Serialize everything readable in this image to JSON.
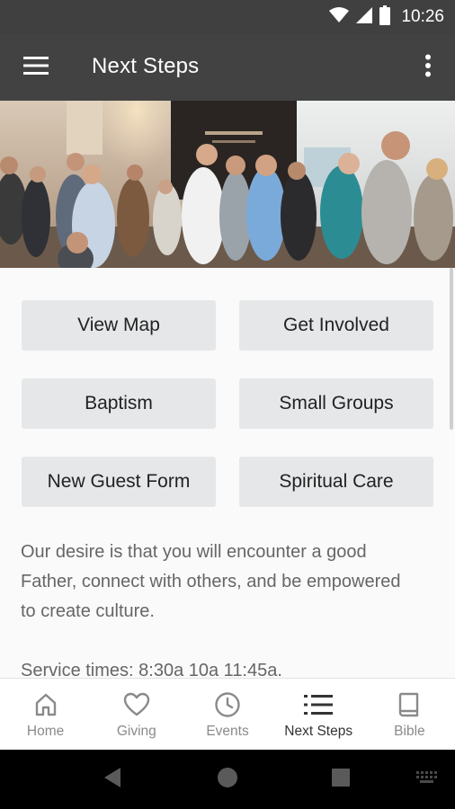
{
  "status_bar": {
    "time": "10:26",
    "icons": [
      "wifi-icon",
      "cellular-icon",
      "battery-icon"
    ]
  },
  "app_bar": {
    "title": "Next Steps",
    "menu_icon": "hamburger-menu-icon",
    "overflow_icon": "more-vert-icon"
  },
  "hero": {
    "description": "photo of people gathered and talking in a church lobby"
  },
  "actions": [
    {
      "label": "View Map"
    },
    {
      "label": "Get Involved"
    },
    {
      "label": "Baptism"
    },
    {
      "label": "Small Groups"
    },
    {
      "label": "New Guest Form"
    },
    {
      "label": "Spiritual Care"
    }
  ],
  "description": "Our desire is that you will encounter a good Father, connect with others, and be empowered to create culture.",
  "service_times": "Service times: 8:30a 10a 11:45a.",
  "bottom_nav": {
    "items": [
      {
        "label": "Home",
        "icon": "home-icon",
        "active": false
      },
      {
        "label": "Giving",
        "icon": "heart-icon",
        "active": false
      },
      {
        "label": "Events",
        "icon": "clock-icon",
        "active": false
      },
      {
        "label": "Next Steps",
        "icon": "list-icon",
        "active": true
      },
      {
        "label": "Bible",
        "icon": "book-icon",
        "active": false
      }
    ]
  },
  "colors": {
    "app_bar": "#424242",
    "status_bar": "#404040",
    "button_bg": "#e5e7e8",
    "body_text": "#666666"
  }
}
